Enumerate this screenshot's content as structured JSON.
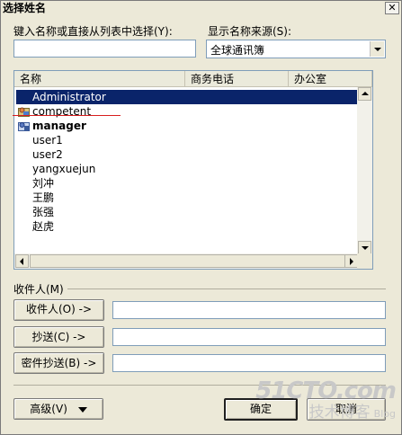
{
  "window": {
    "title": "选择姓名",
    "close_glyph": "✕"
  },
  "search": {
    "label": "键入名称或直接从列表中选择(Y):",
    "value": ""
  },
  "source": {
    "label": "显示名称来源(S):",
    "selected": "全球通讯簿"
  },
  "columns": [
    "名称",
    "商务电话",
    "办公室"
  ],
  "entries": [
    {
      "name": "Administrator",
      "icon": "none",
      "selected": true,
      "bold": false
    },
    {
      "name": "competent",
      "icon": "contact-icon",
      "selected": false,
      "bold": false
    },
    {
      "name": "manager",
      "icon": "contact-icon",
      "selected": false,
      "bold": true
    },
    {
      "name": "user1",
      "icon": "none",
      "selected": false,
      "bold": false
    },
    {
      "name": "user2",
      "icon": "none",
      "selected": false,
      "bold": false
    },
    {
      "name": "yangxuejun",
      "icon": "none",
      "selected": false,
      "bold": false
    },
    {
      "name": "刘冲",
      "icon": "none",
      "selected": false,
      "bold": false
    },
    {
      "name": "王鹏",
      "icon": "none",
      "selected": false,
      "bold": false
    },
    {
      "name": "张强",
      "icon": "none",
      "selected": false,
      "bold": false
    },
    {
      "name": "赵虎",
      "icon": "none",
      "selected": false,
      "bold": false
    }
  ],
  "recipients": {
    "group_label": "收件人(M)",
    "to_button": "收件人(O) ->",
    "cc_button": "抄送(C) ->",
    "bcc_button": "密件抄送(B) ->",
    "to_value": "",
    "cc_value": "",
    "bcc_value": ""
  },
  "footer": {
    "advanced_button": "高级(V)",
    "ok_button": "确定",
    "cancel_button": "取消"
  },
  "watermark": {
    "line1": "51CTO.com",
    "line2": "技术博客",
    "line3": "Blog"
  },
  "colors": {
    "selection": "#0a246a",
    "annotation_line": "#d81e1e",
    "dialog_bg": "#ece9d8"
  }
}
